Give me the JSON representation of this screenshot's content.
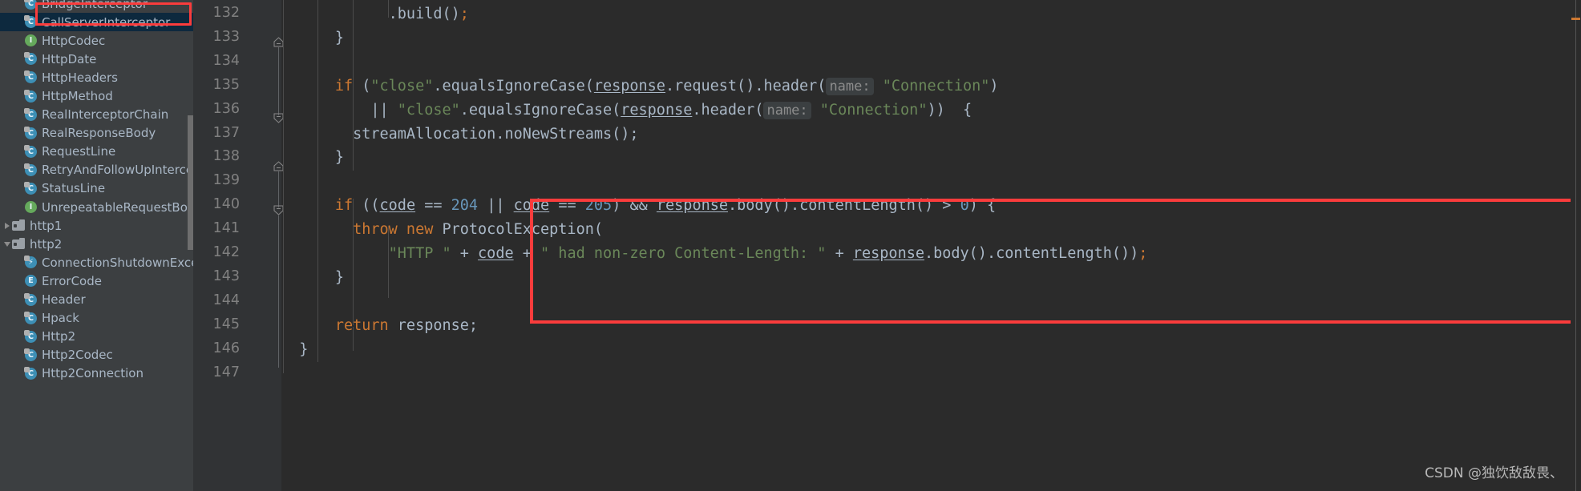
{
  "sidebar": {
    "scrollbar": "vertical-scrollbar",
    "selection_highlight_color": "#fa3c3c",
    "selected_item": "CallServerInterceptor",
    "items": [
      {
        "label": "BridgeInterceptor",
        "icon": "class-icon",
        "indent": 1,
        "arrow": "none",
        "selected": false
      },
      {
        "label": "CallServerInterceptor",
        "icon": "class-icon",
        "indent": 1,
        "arrow": "none",
        "selected": true
      },
      {
        "label": "HttpCodec",
        "icon": "interface-icon",
        "indent": 1,
        "arrow": "none",
        "selected": false
      },
      {
        "label": "HttpDate",
        "icon": "class-icon",
        "indent": 1,
        "arrow": "none",
        "selected": false
      },
      {
        "label": "HttpHeaders",
        "icon": "class-icon",
        "indent": 1,
        "arrow": "none",
        "selected": false
      },
      {
        "label": "HttpMethod",
        "icon": "class-icon",
        "indent": 1,
        "arrow": "none",
        "selected": false
      },
      {
        "label": "RealInterceptorChain",
        "icon": "class-icon",
        "indent": 1,
        "arrow": "none",
        "selected": false
      },
      {
        "label": "RealResponseBody",
        "icon": "class-icon",
        "indent": 1,
        "arrow": "none",
        "selected": false
      },
      {
        "label": "RequestLine",
        "icon": "class-icon",
        "indent": 1,
        "arrow": "none",
        "selected": false
      },
      {
        "label": "RetryAndFollowUpIntercep",
        "icon": "class-icon",
        "indent": 1,
        "arrow": "none",
        "selected": false
      },
      {
        "label": "StatusLine",
        "icon": "class-icon",
        "indent": 1,
        "arrow": "none",
        "selected": false
      },
      {
        "label": "UnrepeatableRequestBody",
        "icon": "interface-icon",
        "indent": 1,
        "arrow": "none",
        "selected": false
      },
      {
        "label": "http1",
        "icon": "folder-icon",
        "indent": 0,
        "arrow": "right",
        "selected": false
      },
      {
        "label": "http2",
        "icon": "folder-icon",
        "indent": 0,
        "arrow": "down",
        "selected": false
      },
      {
        "label": "ConnectionShutdownExcep",
        "icon": "exception-icon",
        "indent": 1,
        "arrow": "none",
        "selected": false
      },
      {
        "label": "ErrorCode",
        "icon": "enum-icon",
        "indent": 1,
        "arrow": "none",
        "selected": false
      },
      {
        "label": "Header",
        "icon": "class-icon",
        "indent": 1,
        "arrow": "none",
        "selected": false
      },
      {
        "label": "Hpack",
        "icon": "class-icon",
        "indent": 1,
        "arrow": "none",
        "selected": false
      },
      {
        "label": "Http2",
        "icon": "class-icon",
        "indent": 1,
        "arrow": "none",
        "selected": false
      },
      {
        "label": "Http2Codec",
        "icon": "class-icon",
        "indent": 1,
        "arrow": "none",
        "selected": false
      },
      {
        "label": "Http2Connection",
        "icon": "class-icon",
        "indent": 1,
        "arrow": "none",
        "selected": false
      }
    ]
  },
  "editor": {
    "highlight_box_color": "#fa3c3c",
    "line_numbers": [
      "132",
      "133",
      "134",
      "135",
      "136",
      "137",
      "138",
      "139",
      "140",
      "141",
      "142",
      "143",
      "144",
      "145",
      "146",
      "147"
    ],
    "lines": [
      {
        "n": "132",
        "tokens": [
          {
            "t": "            .build()",
            "c": "plain"
          },
          {
            "t": ";",
            "c": "kw"
          }
        ]
      },
      {
        "n": "133",
        "tokens": [
          {
            "t": "      }",
            "c": "plain"
          }
        ]
      },
      {
        "n": "134",
        "tokens": [
          {
            "t": "",
            "c": "plain"
          }
        ]
      },
      {
        "n": "135",
        "tokens": [
          {
            "t": "      ",
            "c": "plain"
          },
          {
            "t": "if",
            "c": "kw"
          },
          {
            "t": " (",
            "c": "plain"
          },
          {
            "t": "\"close\"",
            "c": "str"
          },
          {
            "t": ".equalsIgnoreCase(",
            "c": "plain"
          },
          {
            "t": "response",
            "c": "param-u"
          },
          {
            "t": ".request().header(",
            "c": "plain"
          },
          {
            "t": "name:",
            "c": "hint"
          },
          {
            "t": " ",
            "c": "plain"
          },
          {
            "t": "\"Connection\"",
            "c": "str"
          },
          {
            "t": ")",
            "c": "plain"
          }
        ]
      },
      {
        "n": "136",
        "tokens": [
          {
            "t": "          || ",
            "c": "plain"
          },
          {
            "t": "\"close\"",
            "c": "str"
          },
          {
            "t": ".equalsIgnoreCase(",
            "c": "plain"
          },
          {
            "t": "response",
            "c": "param-u"
          },
          {
            "t": ".header(",
            "c": "plain"
          },
          {
            "t": "name:",
            "c": "hint"
          },
          {
            "t": " ",
            "c": "plain"
          },
          {
            "t": "\"Connection\"",
            "c": "str"
          },
          {
            "t": "))  {",
            "c": "plain"
          }
        ]
      },
      {
        "n": "137",
        "tokens": [
          {
            "t": "        streamAllocation.noNewStreams();",
            "c": "plain"
          }
        ]
      },
      {
        "n": "138",
        "tokens": [
          {
            "t": "      }",
            "c": "plain"
          }
        ]
      },
      {
        "n": "139",
        "tokens": [
          {
            "t": "",
            "c": "plain"
          }
        ]
      },
      {
        "n": "140",
        "tokens": [
          {
            "t": "      ",
            "c": "plain"
          },
          {
            "t": "if",
            "c": "kw"
          },
          {
            "t": " ((",
            "c": "plain"
          },
          {
            "t": "code",
            "c": "param-u"
          },
          {
            "t": " == ",
            "c": "plain"
          },
          {
            "t": "204",
            "c": "num"
          },
          {
            "t": " || ",
            "c": "plain"
          },
          {
            "t": "code",
            "c": "param-u"
          },
          {
            "t": " == ",
            "c": "plain"
          },
          {
            "t": "205",
            "c": "num"
          },
          {
            "t": ") && ",
            "c": "plain"
          },
          {
            "t": "response",
            "c": "param-u"
          },
          {
            "t": ".body().contentLength() > ",
            "c": "plain"
          },
          {
            "t": "0",
            "c": "num"
          },
          {
            "t": ") {",
            "c": "plain"
          }
        ]
      },
      {
        "n": "141",
        "tokens": [
          {
            "t": "        ",
            "c": "plain"
          },
          {
            "t": "throw new",
            "c": "kw"
          },
          {
            "t": " ProtocolException(",
            "c": "plain"
          }
        ]
      },
      {
        "n": "142",
        "tokens": [
          {
            "t": "            ",
            "c": "plain"
          },
          {
            "t": "\"HTTP \"",
            "c": "str"
          },
          {
            "t": " + ",
            "c": "plain"
          },
          {
            "t": "code",
            "c": "param-u"
          },
          {
            "t": " + ",
            "c": "plain"
          },
          {
            "t": "\" had non-zero Content-Length: \"",
            "c": "str"
          },
          {
            "t": " + ",
            "c": "plain"
          },
          {
            "t": "response",
            "c": "param-u"
          },
          {
            "t": ".body().contentLength())",
            "c": "plain"
          },
          {
            "t": ";",
            "c": "kw"
          }
        ]
      },
      {
        "n": "143",
        "tokens": [
          {
            "t": "      }",
            "c": "plain"
          }
        ]
      },
      {
        "n": "144",
        "tokens": [
          {
            "t": "",
            "c": "plain"
          }
        ]
      },
      {
        "n": "145",
        "tokens": [
          {
            "t": "      ",
            "c": "plain"
          },
          {
            "t": "return",
            "c": "kw"
          },
          {
            "t": " response;",
            "c": "plain"
          }
        ]
      },
      {
        "n": "146",
        "tokens": [
          {
            "t": "  }",
            "c": "plain"
          }
        ]
      },
      {
        "n": "147",
        "tokens": [
          {
            "t": "",
            "c": "plain"
          }
        ]
      }
    ]
  },
  "watermark": {
    "text": "CSDN @独饮敌敌畏、"
  }
}
